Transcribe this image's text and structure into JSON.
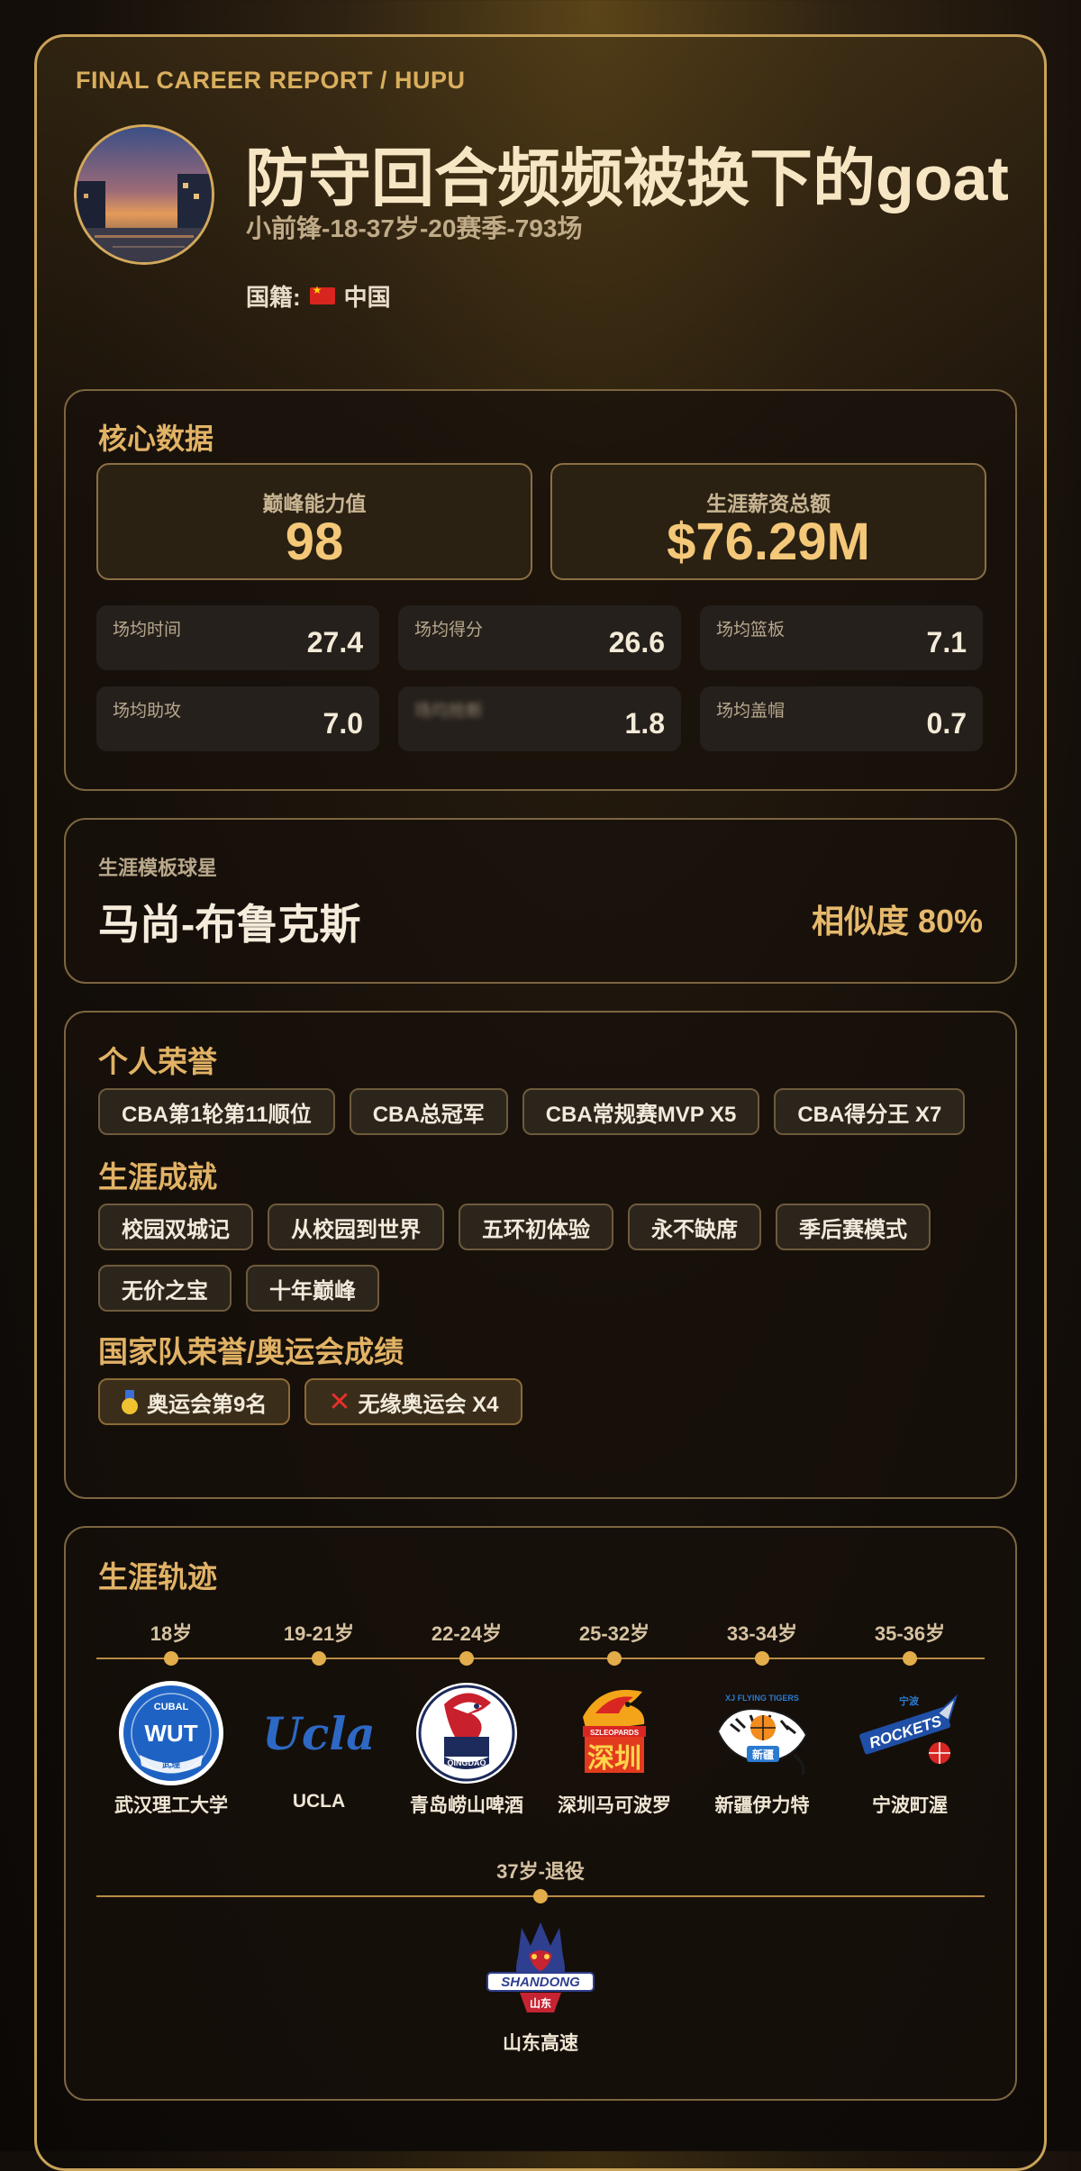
{
  "header": {
    "kicker": "FINAL CAREER REPORT / HUPU",
    "player_name": "防守回合频频被换下的goat",
    "subtitle": "小前锋-18-37岁-20赛季-793场",
    "nationality_label": "国籍:",
    "nationality": "中国"
  },
  "core": {
    "title": "核心数据",
    "peak_label": "巅峰能力值",
    "peak_value": "98",
    "salary_label": "生涯薪资总额",
    "salary_value": "$76.29M",
    "stats": [
      {
        "label": "场均时间",
        "value": "27.4"
      },
      {
        "label": "场均得分",
        "value": "26.6"
      },
      {
        "label": "场均篮板",
        "value": "7.1"
      },
      {
        "label": "场均助攻",
        "value": "7.0"
      },
      {
        "label": "场均抢断",
        "value": "1.8"
      },
      {
        "label": "场均盖帽",
        "value": "0.7"
      }
    ]
  },
  "template": {
    "label": "生涯模板球星",
    "name": "马尚-布鲁克斯",
    "similarity": "相似度 80%"
  },
  "honors": {
    "personal_title": "个人荣誉",
    "personal": [
      "CBA第1轮第11顺位",
      "CBA总冠军",
      "CBA常规赛MVP X5",
      "CBA得分王 X7"
    ],
    "achievements_title": "生涯成就",
    "achievements": [
      "校园双城记",
      "从校园到世界",
      "五环初体验",
      "永不缺席",
      "季后赛模式",
      "无价之宝",
      "十年巅峰"
    ],
    "national_title": "国家队荣誉/奥运会成绩",
    "olympic_result": "奥运会第9名",
    "olympic_miss": "无缘奥运会 X4"
  },
  "timeline": {
    "title": "生涯轨迹",
    "stops": [
      {
        "age": "18岁",
        "team": "武汉理工大学",
        "logo_text": "WUT",
        "logo_top": "CUBAL",
        "logo_bottom": "武理"
      },
      {
        "age": "19-21岁",
        "team": "UCLA",
        "logo_text": "Ucla"
      },
      {
        "age": "22-24岁",
        "team": "青岛崂山啤酒",
        "logo_text": "QINGDAO"
      },
      {
        "age": "25-32岁",
        "team": "深圳马可波罗",
        "logo_text": "深圳",
        "logo_top": "SZLEOPARDS"
      },
      {
        "age": "33-34岁",
        "team": "新疆伊力特",
        "logo_text": "新疆",
        "logo_top": "XJ FLYING TIGERS"
      },
      {
        "age": "35-36岁",
        "team": "宁波町渥",
        "logo_text": "ROCKETS",
        "logo_top": "宁波"
      },
      {
        "age": "37岁-退役",
        "team": "山东高速",
        "logo_text": "SHANDONG",
        "logo_bottom": "山东"
      }
    ]
  },
  "colors": {
    "accent": "#e1b265",
    "border": "#c9a35a",
    "value": "#f4c878"
  }
}
